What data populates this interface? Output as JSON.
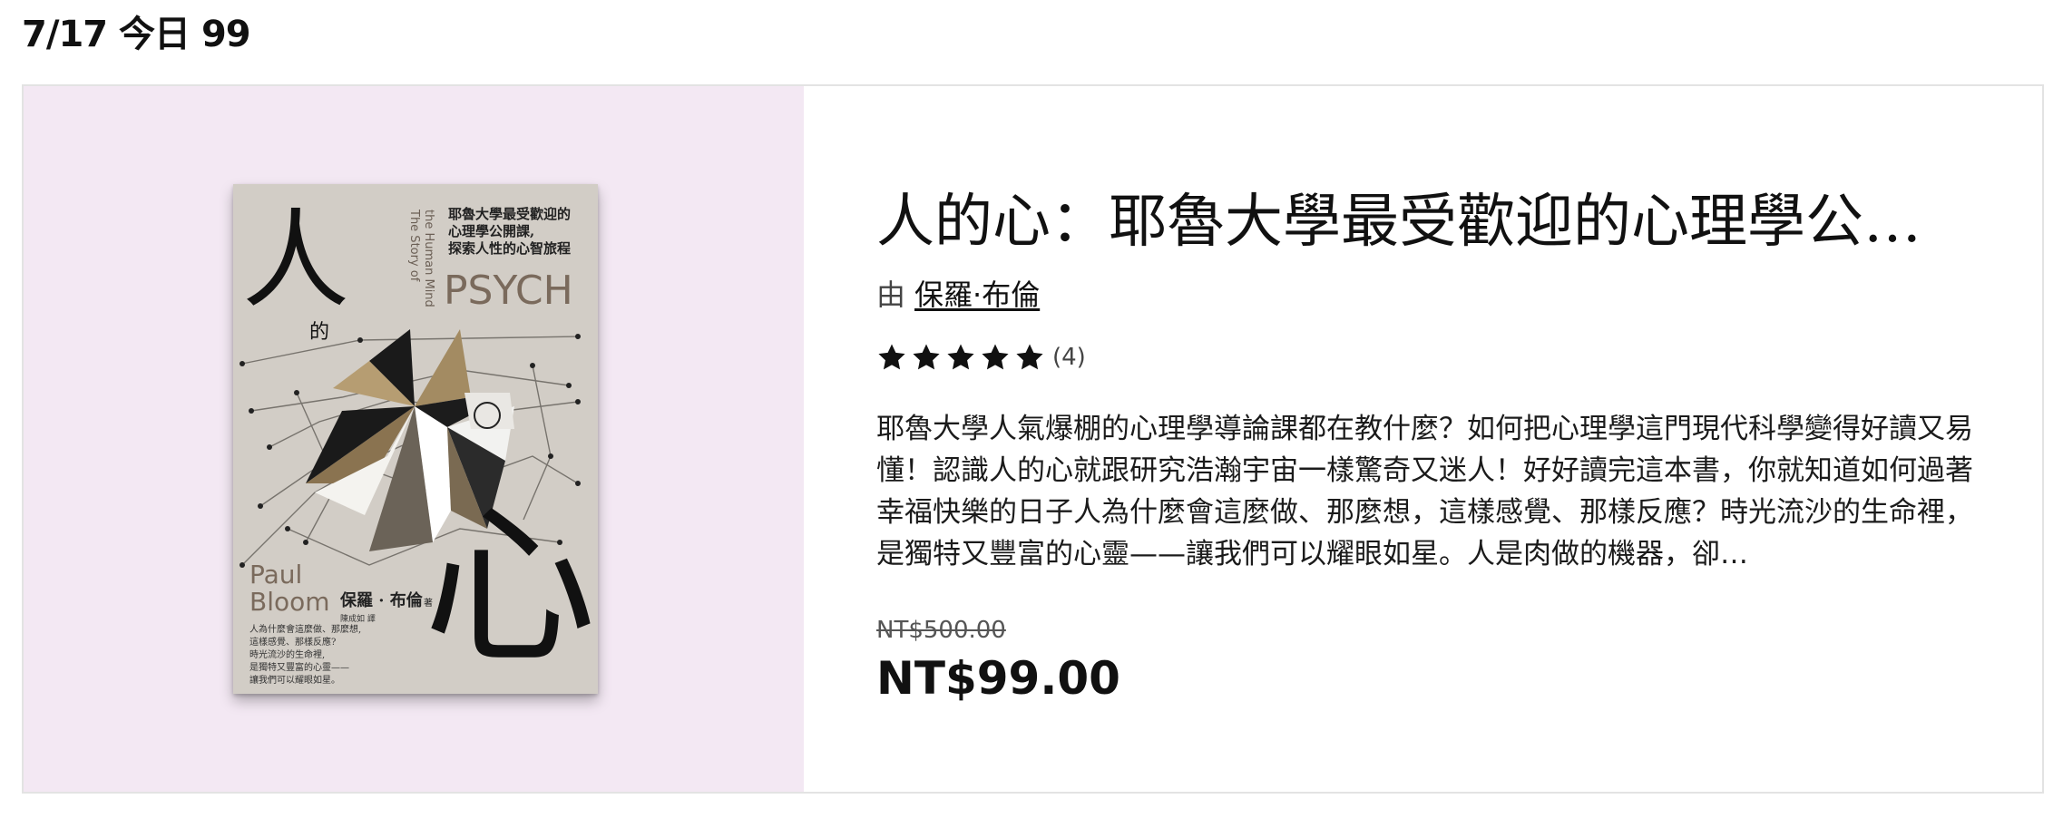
{
  "header": {
    "title": "7/17 今日 99"
  },
  "book": {
    "cover": {
      "big_char_top": "人",
      "small_char": "的",
      "big_char_bottom": "心",
      "subtitle_lines": [
        "耶魯大學最受歡迎的",
        "心理學公開課,",
        "探索人性的心智旅程"
      ],
      "vertical_en_lines": [
        "The Story of",
        "the Human Mind"
      ],
      "psych": "PSYCH",
      "author_en_lines": [
        "Paul",
        "Bloom"
      ],
      "author_cn": "保羅 · 布倫",
      "author_cn_suffix": "著",
      "translator": "陳成如 譯",
      "blurb_lines": [
        "人為什麼會這麼做、那麼想,",
        "這樣感覺、那樣反應?",
        "時光流沙的生命裡,",
        "是獨特又豐富的心靈——",
        "讓我們可以耀眼如星。"
      ]
    },
    "title": "人的心：耶魯大學最受歡迎的心理學公…",
    "by_label": "由",
    "author": "保羅·布倫",
    "rating": {
      "stars": 5,
      "count": "(4)"
    },
    "description": "耶魯大學人氣爆棚的心理學導論課都在教什麼？如何把心理學這門現代科學變得好讀又易懂！認識人的心就跟研究浩瀚宇宙一樣驚奇又迷人！好好讀完這本書，你就知道如何過著幸福快樂的日子人為什麼會這麼做、那麼想，這樣感覺、那樣反應？時光流沙的生命裡，是獨特又豐富的心靈——讓我們可以耀眼如星。人是肉做的機器，卻…",
    "original_price": "NT$500.00",
    "sale_price": "NT$99.00"
  },
  "colors": {
    "cover_panel_bg": "#f3e8f3",
    "book_bg": "#d2cdc6",
    "text": "#111111"
  }
}
